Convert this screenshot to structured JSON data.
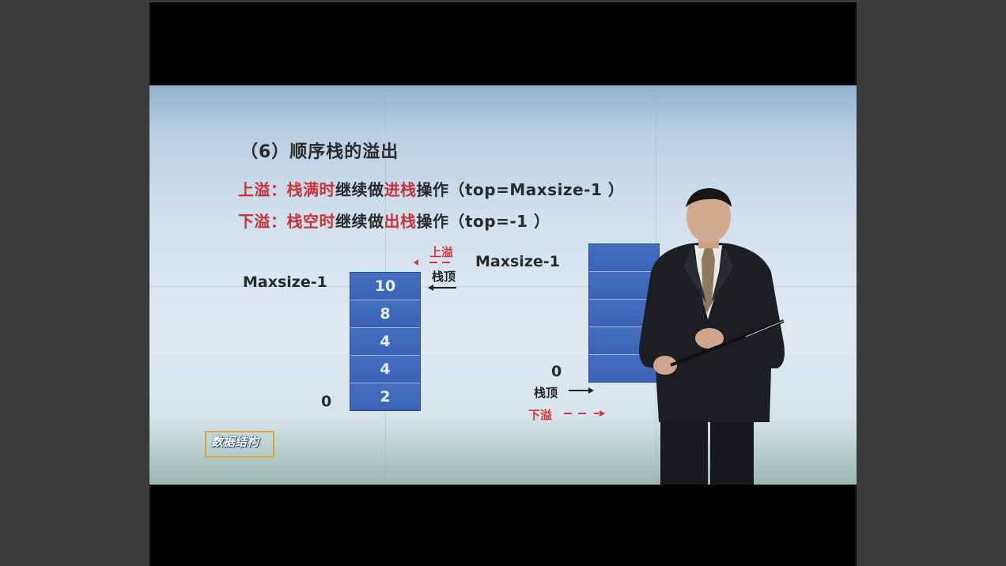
{
  "slide": {
    "title": "（6）顺序栈的溢出",
    "line1": {
      "p1": "上溢：栈满时",
      "p2": "继续做",
      "p3": "进栈",
      "p4": "操作（top=Maxsize-1 ）"
    },
    "line2": {
      "p1": "下溢：栈空时",
      "p2": "继续做",
      "p3": "出栈",
      "p4": "操作（top=-1 ）"
    },
    "left_stack": {
      "top_label": "Maxsize-1",
      "bottom_label": "0",
      "cells": [
        "10",
        "8",
        "4",
        "4",
        "2"
      ],
      "overflow_label": "上溢",
      "top_pointer_label": "栈顶"
    },
    "right_stack": {
      "top_label": "Maxsize-1",
      "bottom_label": "0",
      "cells": [
        "",
        "",
        "",
        "",
        ""
      ],
      "top_pointer_label": "栈顶",
      "underflow_label": "下溢"
    },
    "logo_text": "数据结构"
  },
  "colors": {
    "accent_red": "#c8343a",
    "stack_blue": "#3a62b5",
    "logo_orange": "#e6a23a"
  }
}
